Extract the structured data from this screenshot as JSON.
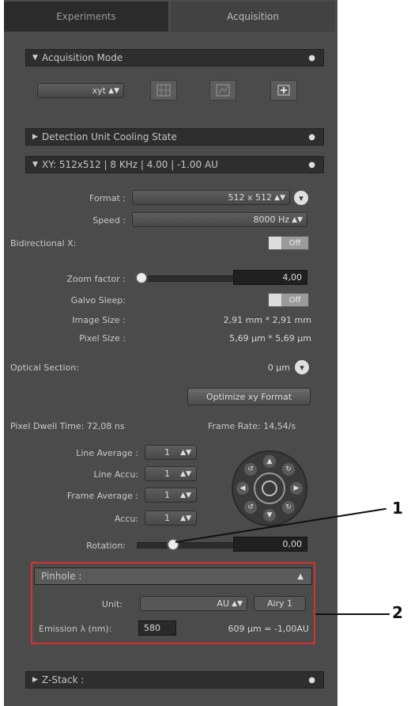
{
  "tabs": [
    "Experiments",
    "Acquisition"
  ],
  "acquisition_mode": {
    "header": "Acquisition Mode",
    "mode_value": "xyt"
  },
  "detection_cooling": {
    "header": "Detection Unit Cooling State"
  },
  "xy_section": {
    "header": "XY: 512x512 | 8 KHz | 4.00 | -1.00 AU",
    "format": {
      "label": "Format :",
      "value": "512 x 512"
    },
    "speed": {
      "label": "Speed :",
      "value": "8000 Hz"
    },
    "bidirectional": {
      "label": "Bidirectional X:",
      "value": "Off"
    },
    "zoom": {
      "label": "Zoom factor :",
      "value": "4,00"
    },
    "galvo": {
      "label": "Galvo Sleep:",
      "value": "Off"
    },
    "image_size": {
      "label": "Image Size :",
      "value": "2,91 mm * 2,91 mm"
    },
    "pixel_size": {
      "label": "Pixel Size :",
      "value": "5,69 µm * 5,69 µm"
    },
    "optical_section": {
      "label": "Optical Section:",
      "value": "0 µm"
    },
    "optimize_label": "Optimize xy Format",
    "pixel_dwell": "Pixel Dwell Time: 72,08 ns",
    "frame_rate": "Frame Rate: 14,54/s",
    "line_average": {
      "label": "Line Average :",
      "value": "1"
    },
    "line_accu": {
      "label": "Line Accu:",
      "value": "1"
    },
    "frame_average": {
      "label": "Frame Average :",
      "value": "1"
    },
    "accu": {
      "label": "Accu:",
      "value": "1"
    },
    "rotation": {
      "label": "Rotation:",
      "value": "0,00"
    }
  },
  "pinhole": {
    "header": "Pinhole :",
    "unit_label": "Unit:",
    "unit_value": "AU",
    "airy_button": "Airy 1",
    "emission_label": "Emission λ (nm):",
    "emission_value": "580",
    "pinhole_value": "609 µm = -1,00AU"
  },
  "z_stack": {
    "header": "Z-Stack :"
  },
  "callouts": [
    "1",
    "2"
  ]
}
